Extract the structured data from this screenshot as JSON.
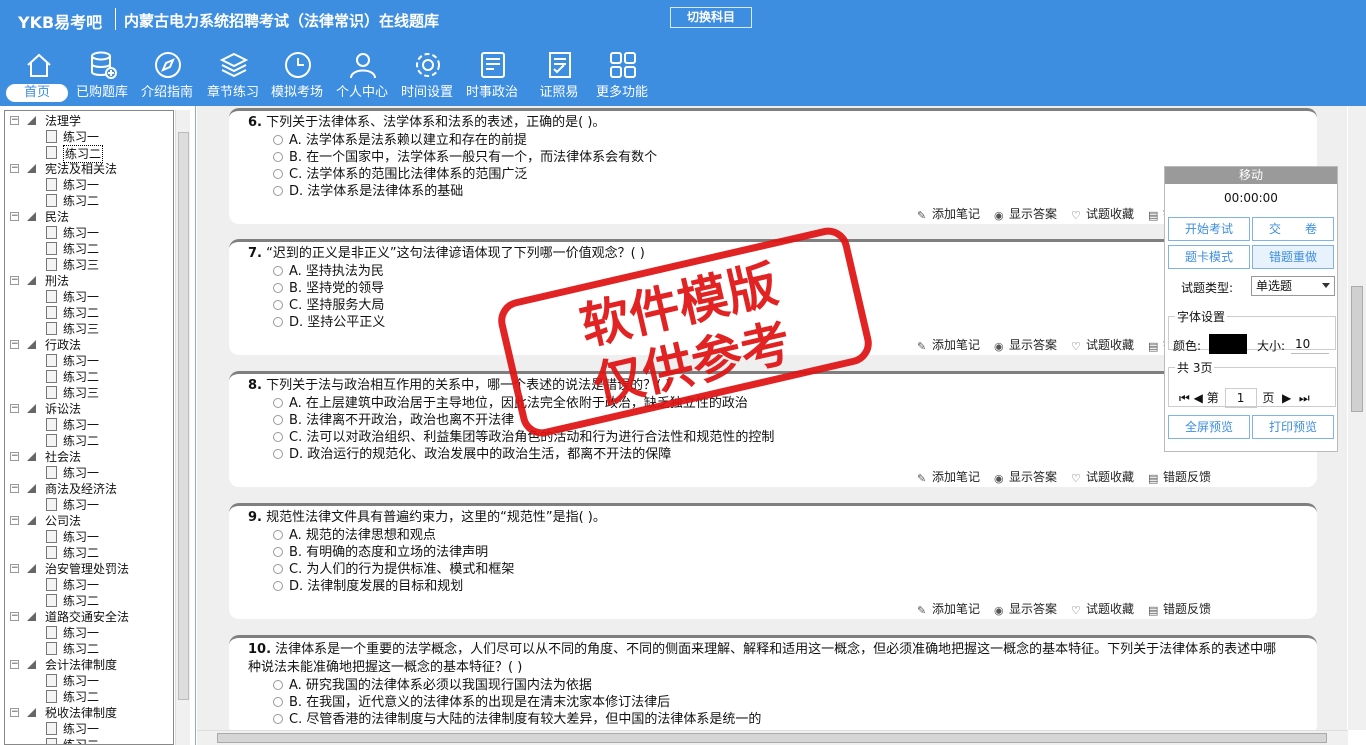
{
  "header": {
    "logo": "YKB易考吧",
    "title": "内蒙古电力系统招聘考试（法律常识）在线题库",
    "switch_label": "切换科目",
    "nav": [
      {
        "label": "首页",
        "icon": "home-icon"
      },
      {
        "label": "已购题库",
        "icon": "database-icon"
      },
      {
        "label": "介绍指南",
        "icon": "compass-icon"
      },
      {
        "label": "章节练习",
        "icon": "layers-icon"
      },
      {
        "label": "模拟考场",
        "icon": "clock-icon"
      },
      {
        "label": "个人中心",
        "icon": "user-icon"
      },
      {
        "label": "时间设置",
        "icon": "gear-icon"
      },
      {
        "label": "时事政治",
        "icon": "newspaper-icon"
      },
      {
        "label": "证照易",
        "icon": "certificate-icon"
      },
      {
        "label": "更多功能",
        "icon": "grid-icon"
      }
    ]
  },
  "tree": [
    {
      "label": "法理学",
      "children": [
        "练习一",
        "练习二"
      ],
      "selected": 1
    },
    {
      "label": "宪法及相关法",
      "children": [
        "练习一",
        "练习二"
      ]
    },
    {
      "label": "民法",
      "children": [
        "练习一",
        "练习二",
        "练习三"
      ]
    },
    {
      "label": "刑法",
      "children": [
        "练习一",
        "练习二",
        "练习三"
      ]
    },
    {
      "label": "行政法",
      "children": [
        "练习一",
        "练习二",
        "练习三"
      ]
    },
    {
      "label": "诉讼法",
      "children": [
        "练习一",
        "练习二"
      ]
    },
    {
      "label": "社会法",
      "children": [
        "练习一"
      ]
    },
    {
      "label": "商法及经济法",
      "children": [
        "练习一"
      ]
    },
    {
      "label": "公司法",
      "children": [
        "练习一",
        "练习二"
      ]
    },
    {
      "label": "治安管理处罚法",
      "children": [
        "练习一",
        "练习二"
      ]
    },
    {
      "label": "道路交通安全法",
      "children": [
        "练习一",
        "练习二"
      ]
    },
    {
      "label": "会计法律制度",
      "children": [
        "练习一",
        "练习二"
      ]
    },
    {
      "label": "税收法律制度",
      "children": [
        "练习一",
        "练习二"
      ]
    }
  ],
  "questions": [
    {
      "num": "6.",
      "text": "下列关于法律体系、法学体系和法系的表述，正确的是( )。",
      "options": [
        "A. 法学体系是法系赖以建立和存在的前提",
        "B. 在一个国家中，法学体系一般只有一个，而法律体系会有数个",
        "C. 法学体系的范围比法律体系的范围广泛",
        "D. 法学体系是法律体系的基础"
      ]
    },
    {
      "num": "7.",
      "text": "“迟到的正义是非正义”这句法律谚语体现了下列哪一价值观念？( )",
      "options": [
        "A. 坚持执法为民",
        "B. 坚持党的领导",
        "C. 坚持服务大局",
        "D. 坚持公平正义"
      ]
    },
    {
      "num": "8.",
      "text": "下列关于法与政治相互作用的关系中，哪一个表述的说法是错误的？( )",
      "options": [
        "A. 在上层建筑中政治居于主导地位，因此法完全依附于政治，缺乏独立性的政治",
        "B. 法律离不开政治，政治也离不开法律",
        "C. 法可以对政治组织、利益集团等政治角色的活动和行为进行合法性和规范性的控制",
        "D. 政治运行的规范化、政治发展中的政治生活，都离不开法的保障"
      ]
    },
    {
      "num": "9.",
      "text": "规范性法律文件具有普遍约束力，这里的“规范性”是指( )。",
      "options": [
        "A. 规范的法律思想和观点",
        "B. 有明确的态度和立场的法律声明",
        "C. 为人们的行为提供标准、模式和框架",
        "D. 法律制度发展的目标和规划"
      ]
    },
    {
      "num": "10.",
      "text": "法律体系是一个重要的法学概念，人们尽可以从不同的角度、不同的侧面来理解、解释和适用这一概念，但必须准确地把握这一概念的基本特征。下列关于法律体系的表述中哪种说法未能准确地把握这一概念的基本特征？( )",
      "options": [
        "A. 研究我国的法律体系必须以我国现行国内法为依据",
        "B. 在我国，近代意义的法律体系的出现是在清末沈家本修订法律后",
        "C. 尽管香港的法律制度与大陆的法律制度有较大差异，但中国的法律体系是统一的"
      ]
    }
  ],
  "actions": {
    "note": "添加笔记",
    "answer": "显示答案",
    "fav": "试题收藏",
    "feedback": "错题反馈"
  },
  "panel": {
    "title": "移动",
    "timer": "00:00:00",
    "start": "开始考试",
    "submit": "交　　卷",
    "card": "题卡模式",
    "redo": "错题重做",
    "type_label": "试题类型:",
    "type_value": "单选题",
    "font_legend": "字体设置",
    "color_label": "颜色:",
    "color_value": "#000000",
    "size_label": "大小:",
    "size_value": "10",
    "page_legend": "共 3页",
    "page_prefix": "第",
    "page_value": "1",
    "page_suffix": "页",
    "fullscreen": "全屏预览",
    "print": "打印预览"
  },
  "watermark": {
    "line1": "软件模版",
    "line2": "仅供参考"
  }
}
